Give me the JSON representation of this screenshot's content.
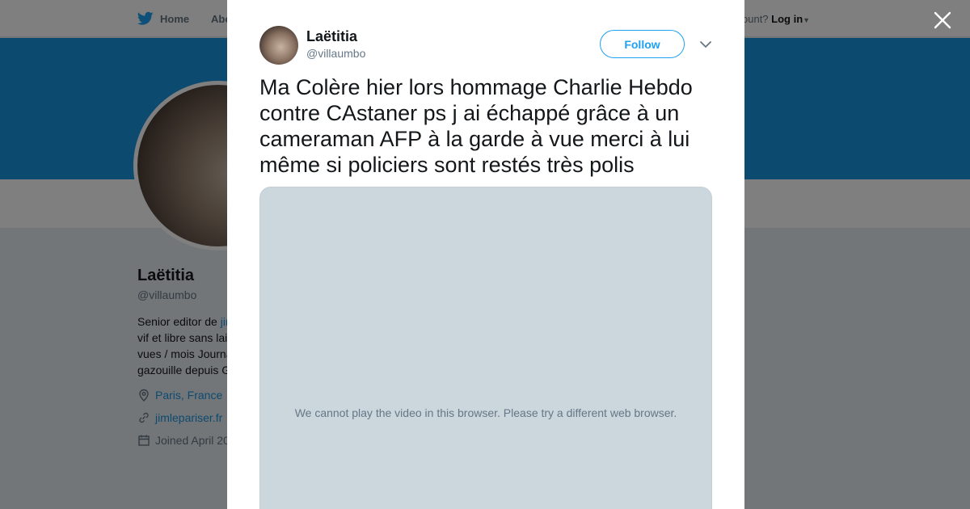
{
  "background": {
    "nav": {
      "home_label": "Home",
      "about_label": "Abo",
      "account_prompt": "ccount?",
      "login_label": "Log in"
    },
    "profile": {
      "name": "Laëtitia",
      "handle": "@villaumbo",
      "bio_lines": [
        {
          "text": "Senior editor de ",
          "link": "jir"
        },
        {
          "text": "vif et libre sans lai",
          "link": ""
        },
        {
          "text": "vues / mois Journa",
          "link": ""
        },
        {
          "text": "gazouille depuis G",
          "link": ""
        }
      ],
      "location": "Paris, France",
      "website": "jimlepariser.fr",
      "joined": "Joined April 20"
    }
  },
  "modal": {
    "author_name": "Laëtitia",
    "author_handle": "@villaumbo",
    "follow_label": "Follow",
    "tweet_text": "Ma Colère hier lors hommage Charlie Hebdo contre CAstaner ps j ai échappé grâce à un cameraman AFP à la garde à vue merci à lui même si policiers sont restés très polis",
    "video_message": "We cannot play the video in this browser. Please try a different web browser."
  },
  "colors": {
    "brand": "#1da1f2",
    "banner": "#1b95e0",
    "video_bg": "#ccd6dd"
  }
}
